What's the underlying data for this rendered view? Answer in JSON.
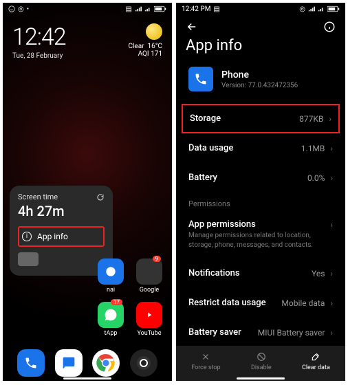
{
  "left": {
    "status": {
      "time": ""
    },
    "clock": {
      "time": "12:42",
      "date": "Tue, 28 February"
    },
    "weather": {
      "cond": "Clear",
      "temp": "16°C",
      "aqi": "AQI 171"
    },
    "popup": {
      "title": "Screen time",
      "duration": "4h 27m",
      "appinfo": "App info"
    },
    "apps": {
      "nai": "nai",
      "google": "Google",
      "app_badge": "9",
      "app_badge2": "17",
      "app": "tApp",
      "youtube": "YouTube"
    }
  },
  "right": {
    "status": {
      "time": "12:42 PM"
    },
    "title": "App info",
    "app": {
      "name": "Phone",
      "version": "Version: 77.0.432472356"
    },
    "rows": {
      "storage": {
        "label": "Storage",
        "value": "877KB"
      },
      "data": {
        "label": "Data usage",
        "value": "1.1MB"
      },
      "battery": {
        "label": "Battery",
        "value": "0.0%"
      },
      "perms_section": "Permissions",
      "perms": {
        "label": "App permissions",
        "desc": "Manage permissions related to location, storage, phone, messages, and contacts."
      },
      "notif": {
        "label": "Notifications",
        "value": "Yes"
      },
      "restrict": {
        "label": "Restrict data usage",
        "value": "Mobile data"
      },
      "saver": {
        "label": "Battery saver",
        "value": "MIUI Battery saver"
      }
    },
    "bottom": {
      "force": "Force stop",
      "disable": "Disable",
      "clear": "Clear data"
    }
  }
}
